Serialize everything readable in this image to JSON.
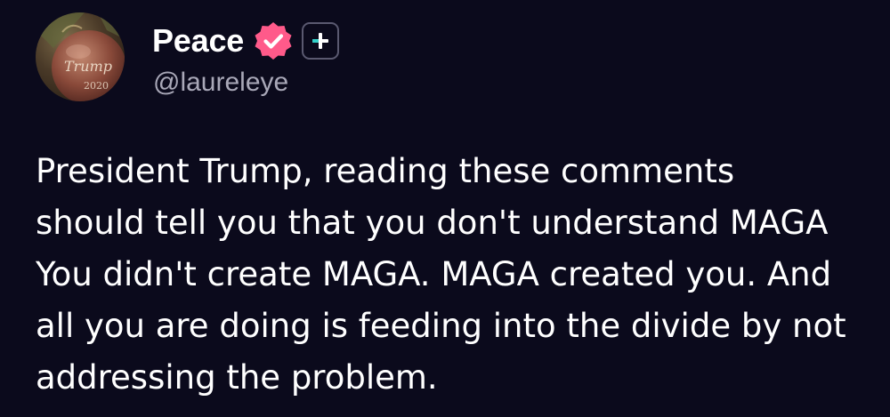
{
  "colors": {
    "background": "#0b0a1c",
    "text_primary": "#ffffff",
    "text_secondary": "#a9a8b8",
    "verified_badge": "#ff5a8a",
    "plus_icon_accent": "#31d0c8"
  },
  "author": {
    "display_name": "Peace",
    "handle": "@laureleye",
    "avatar_icon": "avatar-ornament",
    "verified_icon": "verified-badge-icon",
    "plus_icon": "plus-icon"
  },
  "post": {
    "lines": [
      "President Trump, reading these comments",
      "should tell you that you don't understand MAGA",
      "You didn't create MAGA. MAGA created you. And",
      "all you are doing is feeding into the divide by not",
      "addressing the problem."
    ]
  }
}
